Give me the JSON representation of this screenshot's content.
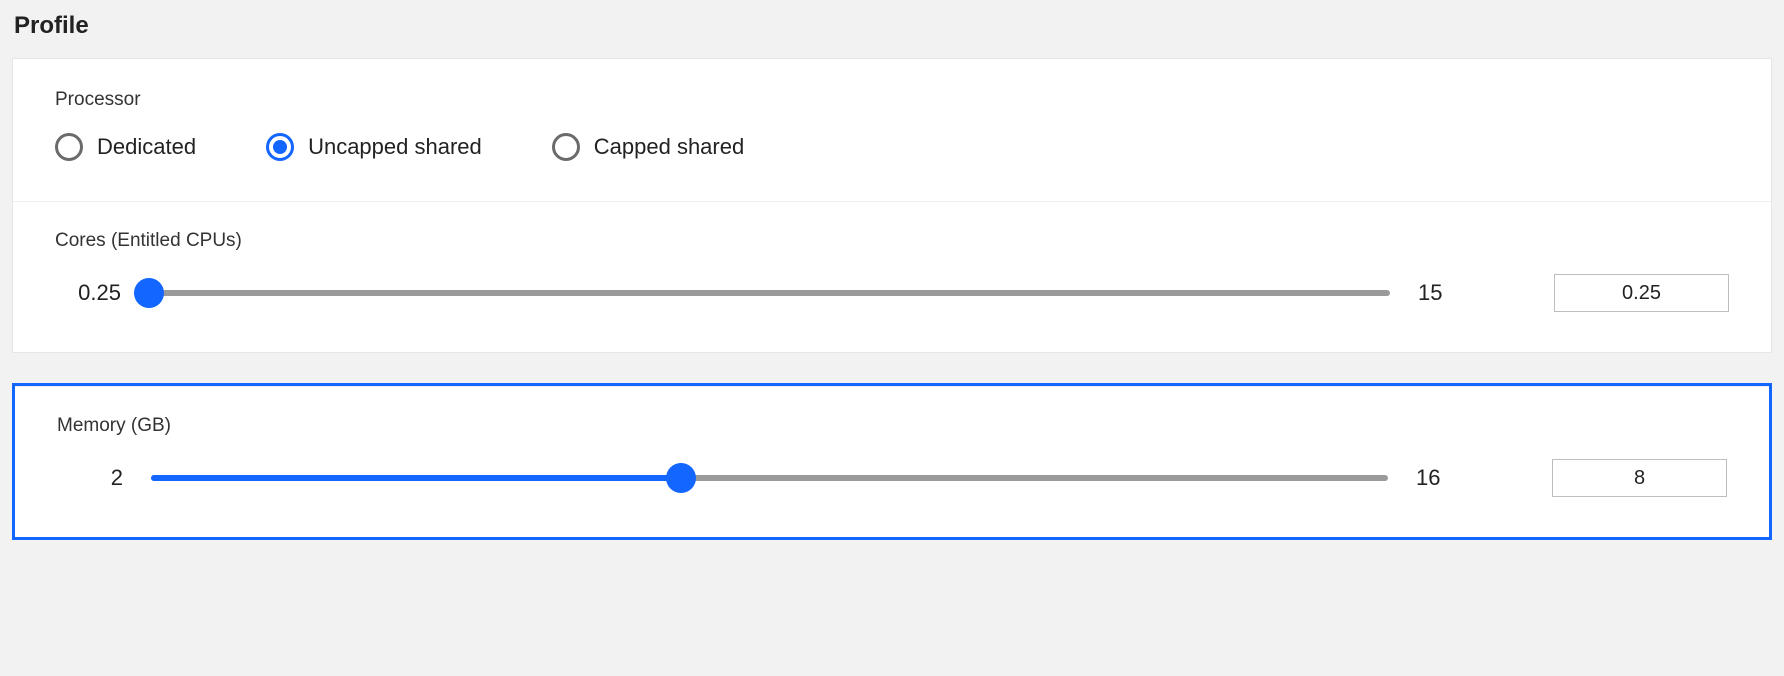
{
  "title": "Profile",
  "accent": "#1366ff",
  "processor": {
    "label": "Processor",
    "options": [
      {
        "id": "dedicated",
        "label": "Dedicated",
        "selected": false
      },
      {
        "id": "uncapped",
        "label": "Uncapped shared",
        "selected": true
      },
      {
        "id": "capped",
        "label": "Capped shared",
        "selected": false
      }
    ]
  },
  "cores": {
    "label": "Cores (Entitled CPUs)",
    "min": "0.25",
    "max": "15",
    "value": "0.25",
    "percent": 0
  },
  "memory": {
    "label": "Memory (GB)",
    "min": "2",
    "max": "16",
    "value": "8",
    "percent": 42.86
  }
}
